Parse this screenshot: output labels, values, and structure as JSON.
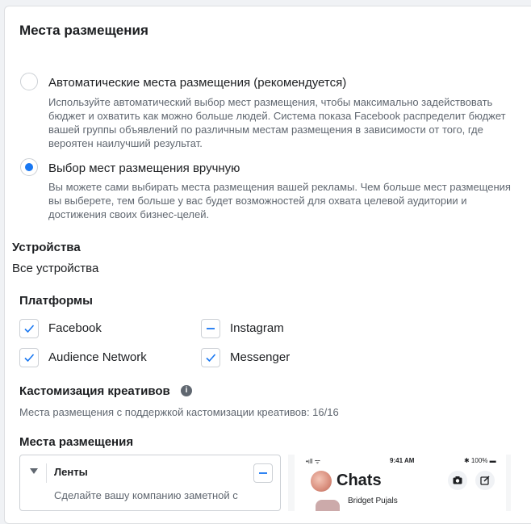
{
  "header": {
    "title": "Места размещения"
  },
  "placement_options": [
    {
      "title": "Автоматические места размещения (рекомендуется)",
      "description": "Используйте автоматический выбор мест размещения, чтобы максимально задействовать бюджет и охватить как можно больше людей. Система показа Facebook распределит бюджет вашей группы объявлений по различным местам размещения в зависимости от того, где вероятен наилучший результат.",
      "selected": false
    },
    {
      "title": "Выбор мест размещения вручную",
      "description": "Вы можете сами выбирать места размещения вашей рекламы. Чем больше мест размещения вы выберете, тем больше у вас будет возможностей для охвата целевой аудитории и достижения своих бизнес-целей.",
      "selected": true
    }
  ],
  "devices": {
    "label": "Устройства",
    "value": "Все устройства"
  },
  "platforms": {
    "label": "Платформы",
    "items": [
      {
        "name": "Facebook",
        "state": "checked"
      },
      {
        "name": "Instagram",
        "state": "indeterminate"
      },
      {
        "name": "Audience Network",
        "state": "checked"
      },
      {
        "name": "Messenger",
        "state": "checked"
      }
    ]
  },
  "creative_customization": {
    "label": "Кастомизация креативов",
    "info_icon": "info-icon",
    "subtitle": "Места размещения с поддержкой кастомизации креативов: 16/16"
  },
  "placements_section": {
    "label": "Места размещения",
    "feed": {
      "title": "Ленты",
      "description": "Сделайте вашу компанию заметной с"
    }
  },
  "preview": {
    "status_left": "•ıll ᯤ",
    "status_time": "9:41 AM",
    "status_right": "✱ 100% ▬",
    "title": "Chats",
    "chat_name": "Bridget Pujals"
  },
  "colors": {
    "accent": "#1877f2",
    "text": "#1c1e21",
    "muted": "#606770",
    "border": "#ccd0d5"
  }
}
